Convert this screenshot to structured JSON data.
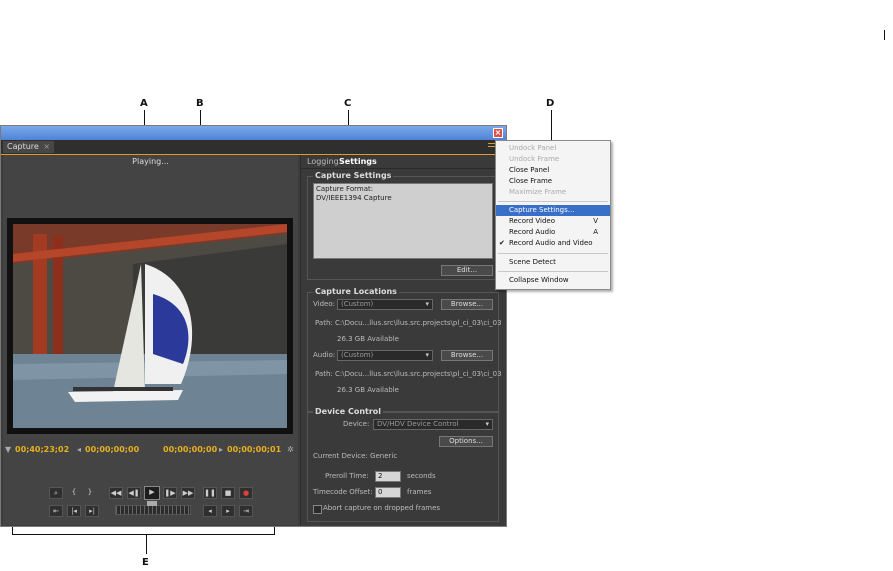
{
  "callouts": {
    "a": "A",
    "b": "B",
    "c": "C",
    "d": "D",
    "e": "E"
  },
  "panel": {
    "tab_label": "Capture",
    "tab_close": "×",
    "status": "Playing..."
  },
  "timecode": {
    "current": "00;40;23;02",
    "in_point": "00;00;00;00",
    "out_point": "00;00;00;00",
    "duration": "00;00;00;01"
  },
  "transport": {
    "play": "▶",
    "stop": "■",
    "record": "●",
    "pause": "❚❚",
    "rewind": "◀◀",
    "fast_forward": "▶▶",
    "step_back": "◀❚",
    "step_forward": "❚▶"
  },
  "tabs": {
    "logging": "Logging",
    "settings": "Settings"
  },
  "capture_settings": {
    "title": "Capture Settings",
    "line1": "Capture Format:",
    "line2": "DV/IEEE1394 Capture",
    "edit_button": "Edit..."
  },
  "capture_locations": {
    "title": "Capture Locations",
    "video_label": "Video:",
    "video_value": "(Custom)",
    "video_browse": "Browse...",
    "video_path": "Path:  C:\\Docu...llus.src\\llus.src.projects\\pl_ci_03\\ci_03",
    "video_available": "26.3 GB Available",
    "audio_label": "Audio:",
    "audio_value": "(Custom)",
    "audio_browse": "Browse...",
    "audio_path": "Path:  C:\\Docu...llus.src\\llus.src.projects\\pl_ci_03\\ci_03",
    "audio_available": "26.3 GB Available"
  },
  "device_control": {
    "title": "Device Control",
    "device_label": "Device:",
    "device_value": "DV/HDV Device Control",
    "options_button": "Options...",
    "current_device": "Current Device:  Generic",
    "preroll_label": "Preroll Time:",
    "preroll_value": "2",
    "preroll_unit": "seconds",
    "offset_label": "Timecode Offset:",
    "offset_value": "0",
    "offset_unit": "frames",
    "abort_label": "Abort capture on dropped frames"
  },
  "menu": {
    "undock_panel": "Undock Panel",
    "undock_frame": "Undock Frame",
    "close_panel": "Close Panel",
    "close_frame": "Close Frame",
    "maximize_frame": "Maximize Frame",
    "capture_settings": "Capture Settings...",
    "record_video": "Record Video",
    "record_video_shortcut": "V",
    "record_audio": "Record Audio",
    "record_audio_shortcut": "A",
    "record_av": "Record Audio and Video",
    "scene_detect": "Scene Detect",
    "collapse_window": "Collapse Window"
  },
  "colors": {
    "accent": "#e09a2a",
    "timecode": "#e8b020",
    "menu_highlight": "#3a6fc8"
  }
}
